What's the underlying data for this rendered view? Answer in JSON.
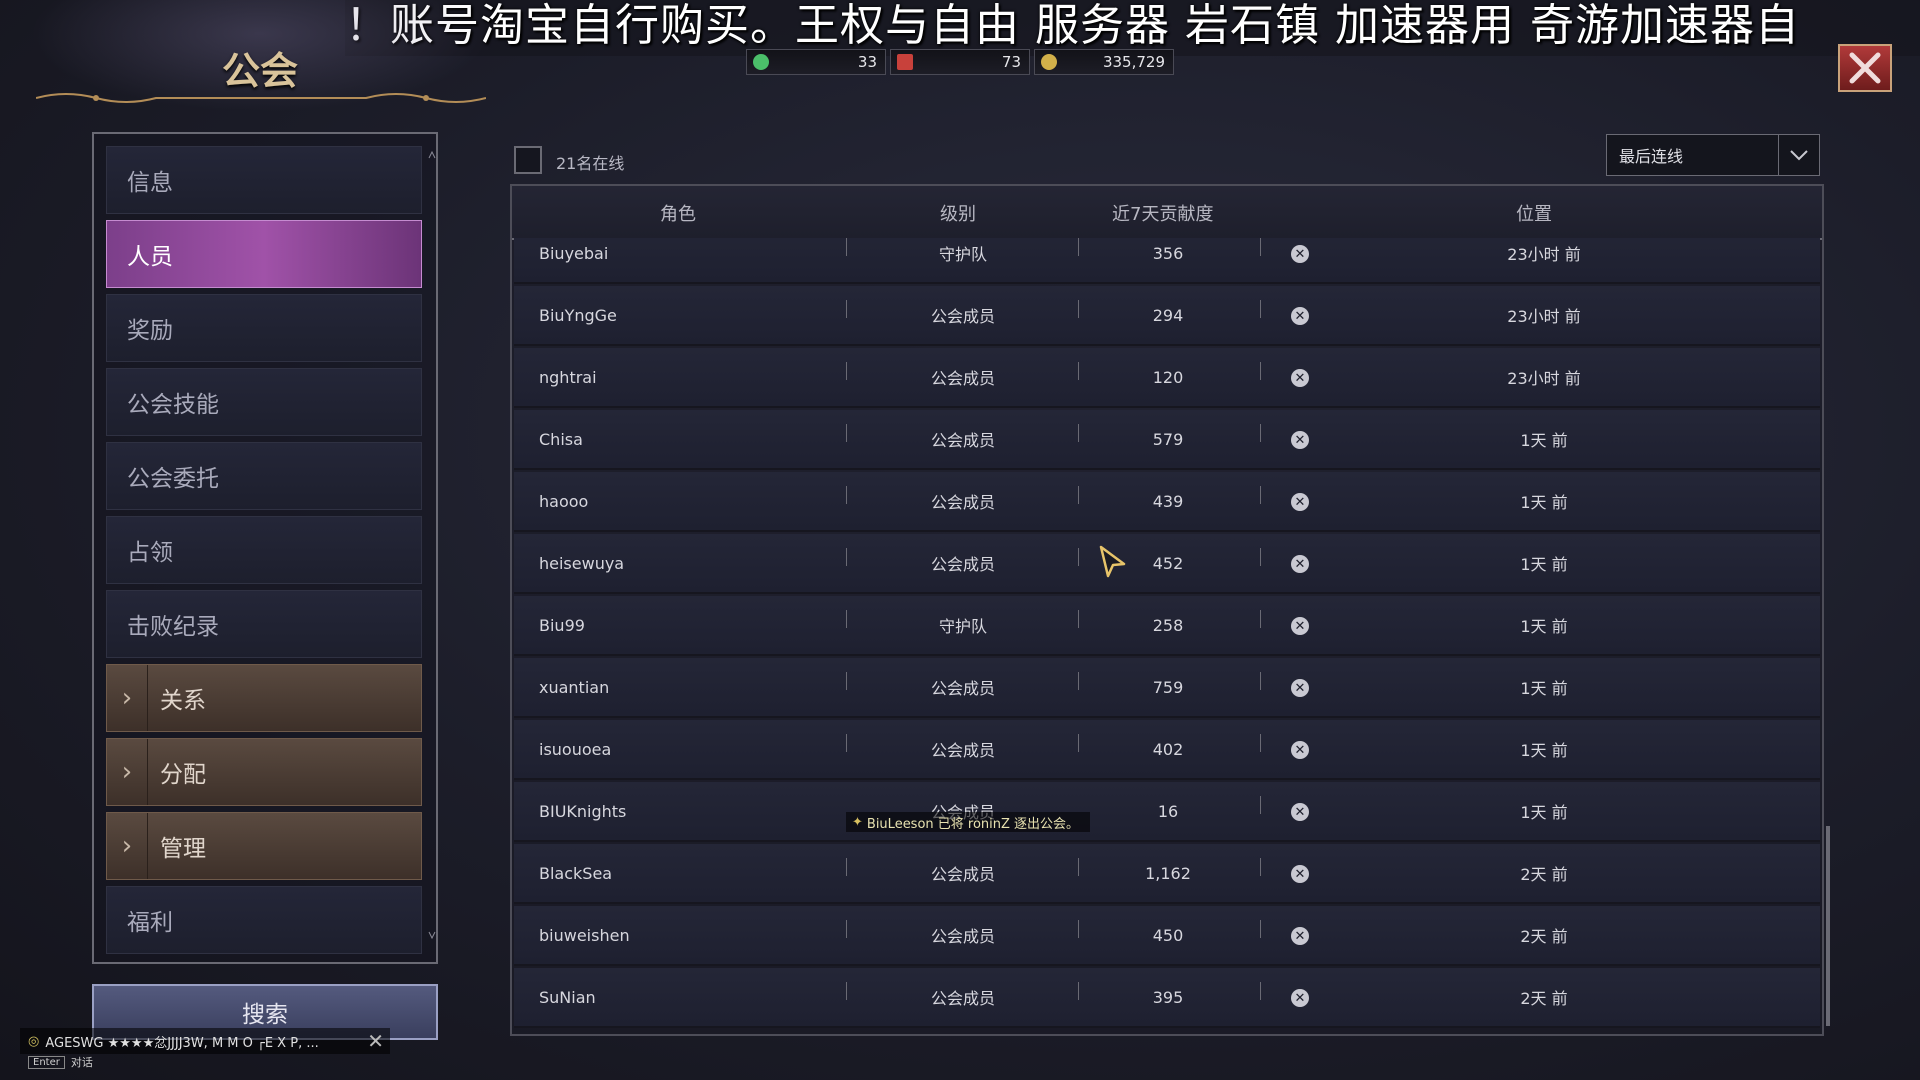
{
  "banner": {
    "text": "！账号淘宝自行购买。王权与自由 服务器 岩石镇 加速器用 奇游加速器自"
  },
  "guild": {
    "title": "公会"
  },
  "currency": [
    {
      "icon": "gem-icon",
      "value": "33",
      "color": "#4bbf6a"
    },
    {
      "icon": "ticket-icon",
      "value": "73",
      "color": "#c8413b"
    },
    {
      "icon": "gold-coin-icon",
      "value": "335,729",
      "color": "#d2b04a"
    }
  ],
  "menu": {
    "items": [
      {
        "label": "信息",
        "state": "normal"
      },
      {
        "label": "人员",
        "state": "active"
      },
      {
        "label": "奖励",
        "state": "normal"
      },
      {
        "label": "公会技能",
        "state": "normal"
      },
      {
        "label": "公会委托",
        "state": "normal"
      },
      {
        "label": "占领",
        "state": "normal"
      },
      {
        "label": "击败纪录",
        "state": "normal"
      },
      {
        "label": "关系",
        "state": "group"
      },
      {
        "label": "分配",
        "state": "group"
      },
      {
        "label": "管理",
        "state": "group"
      },
      {
        "label": "福利",
        "state": "normal"
      }
    ],
    "search_label": "搜索"
  },
  "roster": {
    "online_text": "21名在线",
    "sort_value": "最后连线",
    "columns": [
      "角色",
      "级别",
      "近7天贡献度",
      "位置"
    ],
    "rows": [
      {
        "name": "Biuyebai",
        "rank": "守护队",
        "contribution": "356",
        "last": "23小时 前"
      },
      {
        "name": "BiuYngGe",
        "rank": "公会成员",
        "contribution": "294",
        "last": "23小时 前"
      },
      {
        "name": "nghtrai",
        "rank": "公会成员",
        "contribution": "120",
        "last": "23小时 前"
      },
      {
        "name": "Chisa",
        "rank": "公会成员",
        "contribution": "579",
        "last": "1天 前"
      },
      {
        "name": "haooo",
        "rank": "公会成员",
        "contribution": "439",
        "last": "1天 前"
      },
      {
        "name": "heisewuya",
        "rank": "公会成员",
        "contribution": "452",
        "last": "1天 前"
      },
      {
        "name": "Biu99",
        "rank": "守护队",
        "contribution": "258",
        "last": "1天 前"
      },
      {
        "name": "xuantian",
        "rank": "公会成员",
        "contribution": "759",
        "last": "1天 前"
      },
      {
        "name": "isuouoea",
        "rank": "公会成员",
        "contribution": "402",
        "last": "1天 前"
      },
      {
        "name": "BIUKnights",
        "rank": "公会成员",
        "contribution": "16",
        "last": "1天 前"
      },
      {
        "name": "BlackSea",
        "rank": "公会成员",
        "contribution": "1,162",
        "last": "2天 前"
      },
      {
        "name": "biuweishen",
        "rank": "公会成员",
        "contribution": "450",
        "last": "2天 前"
      },
      {
        "name": "SuNian",
        "rank": "公会成员",
        "contribution": "395",
        "last": "2天 前"
      }
    ]
  },
  "toast": {
    "text": "BiuLeeson 已将 roninZ 逐出公会。"
  },
  "chat": {
    "text": "AGESWG ★★★★忿JJJJ3W, M M  O ┌E X P, ...",
    "hint_key": "Enter",
    "hint_label": "对话"
  },
  "colors": {
    "active_tab": "#9b4fa6",
    "group_tab": "#4d3d33",
    "panel": "#1e2030"
  }
}
